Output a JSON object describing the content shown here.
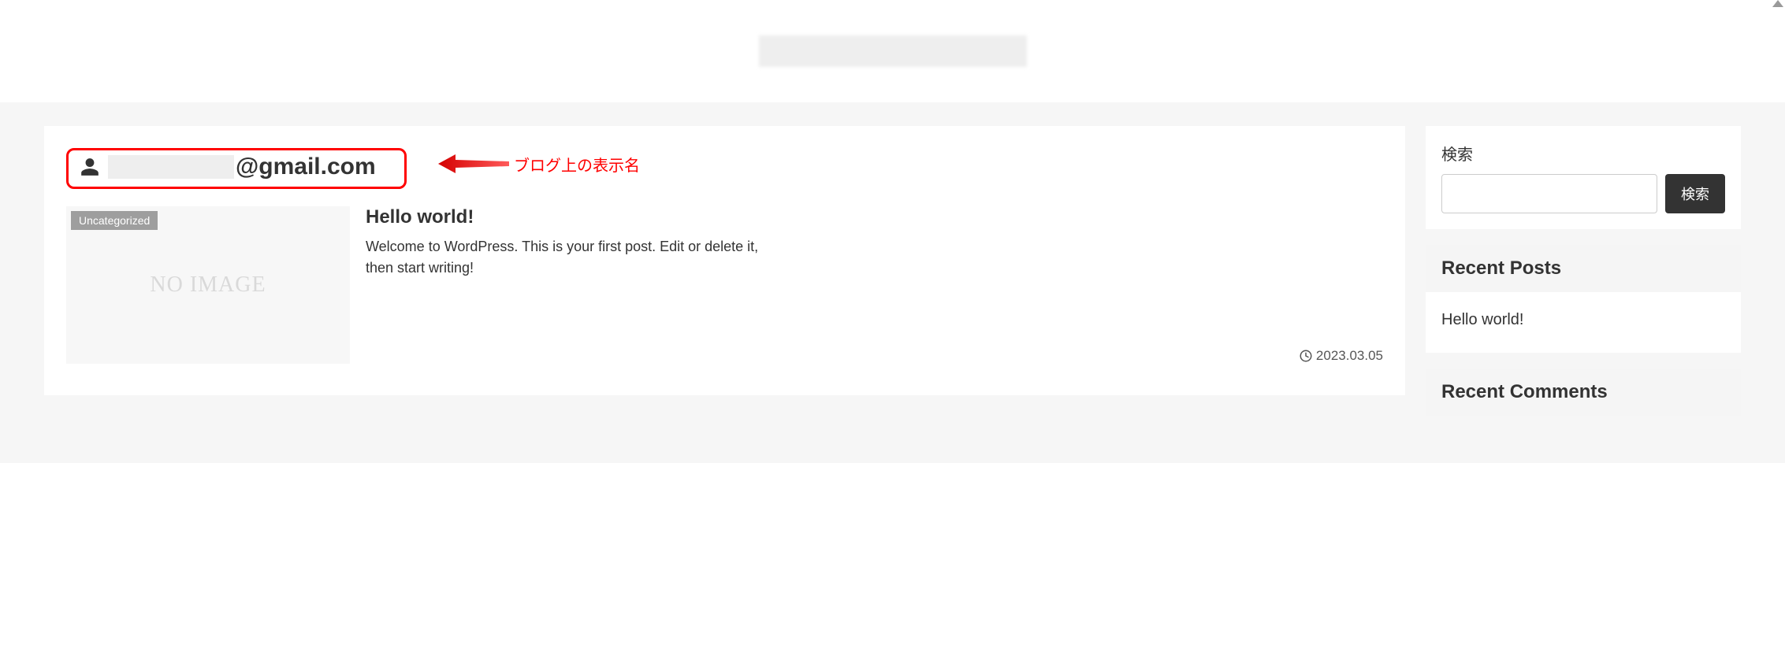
{
  "header": {
    "site_title_blurred": true
  },
  "author": {
    "icon": "user-icon",
    "name_masked": true,
    "domain_text": "@gmail.com"
  },
  "annotation": {
    "label": "ブログ上の表示名"
  },
  "post": {
    "category_badge": "Uncategorized",
    "thumbnail_placeholder": "NO IMAGE",
    "title": "Hello world!",
    "excerpt": "Welcome to WordPress. This is your first post. Edit or delete it, then start writing!",
    "date": "2023.03.05"
  },
  "sidebar": {
    "search": {
      "label": "検索",
      "button": "検索",
      "input_value": ""
    },
    "recent_posts": {
      "heading": "Recent Posts",
      "items": [
        "Hello world!"
      ]
    },
    "recent_comments": {
      "heading": "Recent Comments"
    }
  }
}
